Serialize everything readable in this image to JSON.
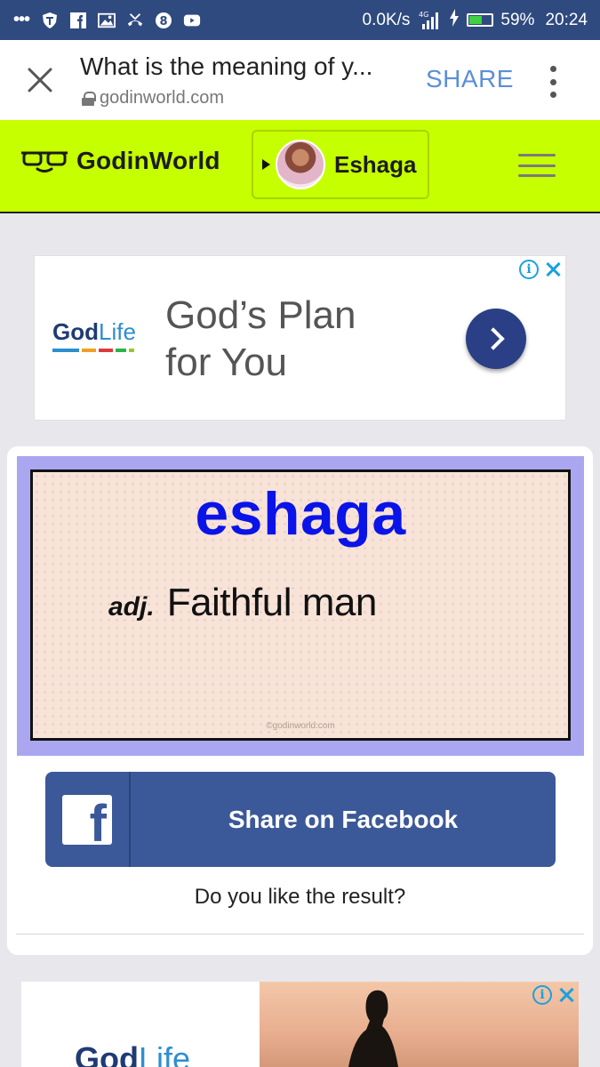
{
  "status_bar": {
    "net_speed": "0.0K/s",
    "network": "4G",
    "battery": "59%",
    "battery_level": 0.59,
    "time": "20:24"
  },
  "browser": {
    "title": "What is the meaning of y...",
    "url": "godinworld.com",
    "share_label": "SHARE"
  },
  "site": {
    "brand": "GodinWorld",
    "user_name": "Eshaga",
    "colors": {
      "header": "#c6ff00",
      "status_bar": "#2f4a7f"
    }
  },
  "ad_top": {
    "brand_prefix": "God",
    "brand_suffix": "Life",
    "headline_line1": "God’s Plan",
    "headline_line2": "for You"
  },
  "result": {
    "word": "eshaga",
    "part_of_speech": "adj.",
    "meaning": "Faithful man",
    "watermark": "©godinworld.com",
    "share_button": "Share on Facebook",
    "question": "Do you like the result?",
    "colors": {
      "word": "#0a14e8",
      "facebook": "#3b5998",
      "frame": "#aaa7f0"
    }
  },
  "ad_bottom": {
    "brand_prefix": "God",
    "brand_suffix": "Life"
  }
}
